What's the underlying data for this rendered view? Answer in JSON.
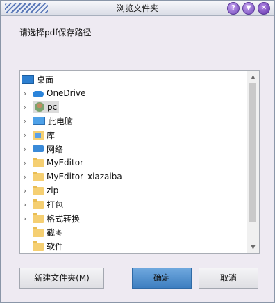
{
  "window": {
    "title": "浏览文件夹"
  },
  "dialog": {
    "prompt": "请选择pdf保存路径"
  },
  "tree": {
    "items": [
      {
        "label": "桌面",
        "icon": "desktop-icon",
        "chevron": ""
      },
      {
        "label": "OneDrive",
        "icon": "cloud-icon",
        "chevron": "›"
      },
      {
        "label": "pc",
        "icon": "user-icon",
        "chevron": "›",
        "selected": true
      },
      {
        "label": "此电脑",
        "icon": "computer-icon",
        "chevron": "›"
      },
      {
        "label": "库",
        "icon": "library-icon",
        "chevron": "›"
      },
      {
        "label": "网络",
        "icon": "network-icon",
        "chevron": "›"
      },
      {
        "label": "MyEditor",
        "icon": "folder-icon",
        "chevron": "›"
      },
      {
        "label": "MyEditor_xiazaiba",
        "icon": "folder-icon",
        "chevron": "›"
      },
      {
        "label": "zip",
        "icon": "folder-icon",
        "chevron": "›"
      },
      {
        "label": "打包",
        "icon": "folder-icon",
        "chevron": "›"
      },
      {
        "label": "格式转换",
        "icon": "folder-icon",
        "chevron": "›"
      },
      {
        "label": "截图",
        "icon": "folder-icon",
        "chevron": ""
      },
      {
        "label": "软件",
        "icon": "folder-icon",
        "chevron": ""
      }
    ]
  },
  "buttons": {
    "new_folder": "新建文件夹(M)",
    "ok": "确定",
    "cancel": "取消"
  },
  "titlebar_buttons": {
    "help": "?",
    "minimize": "▼",
    "close": "✕"
  }
}
